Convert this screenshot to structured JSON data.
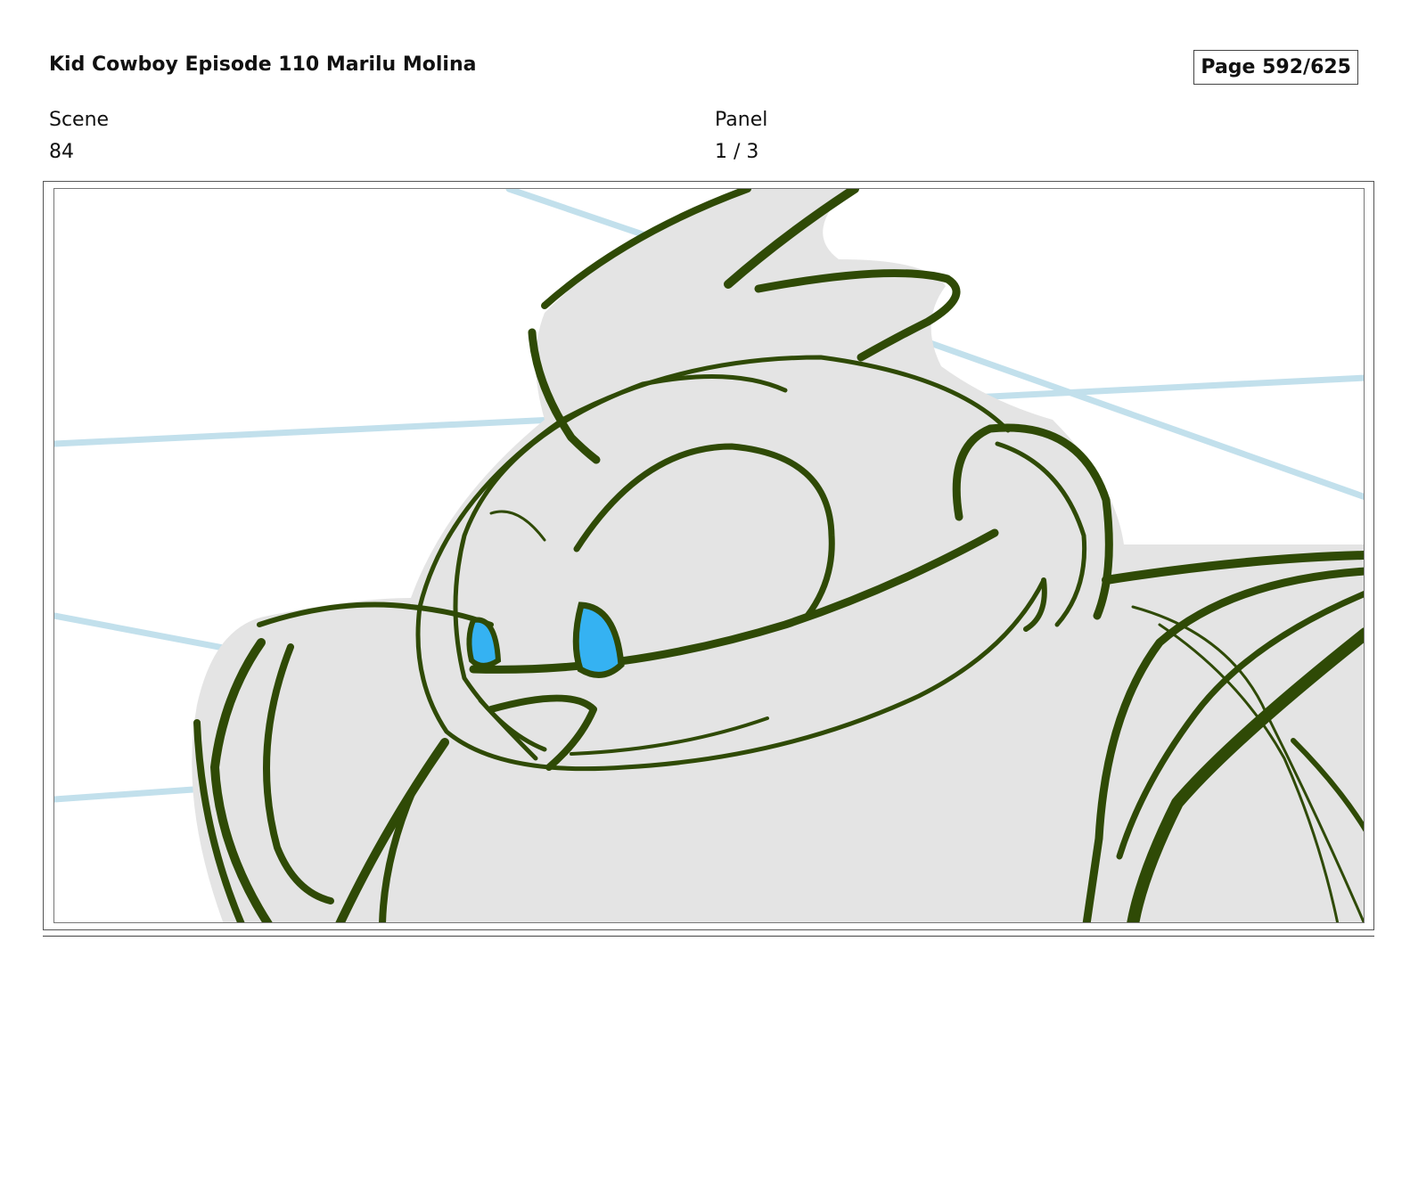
{
  "header": {
    "title": "Kid Cowboy Episode 110 Marilu Molina",
    "page": "Page 592/625"
  },
  "meta": {
    "scene_label": "Scene",
    "scene_value": "84",
    "panel_label": "Panel",
    "panel_value": "1 / 3"
  },
  "drawing": {
    "line_color": "#2f4a06",
    "fill_color": "#e4e4e4",
    "eye_color": "#35b2f2",
    "guide_color": "#c2e0ec"
  }
}
